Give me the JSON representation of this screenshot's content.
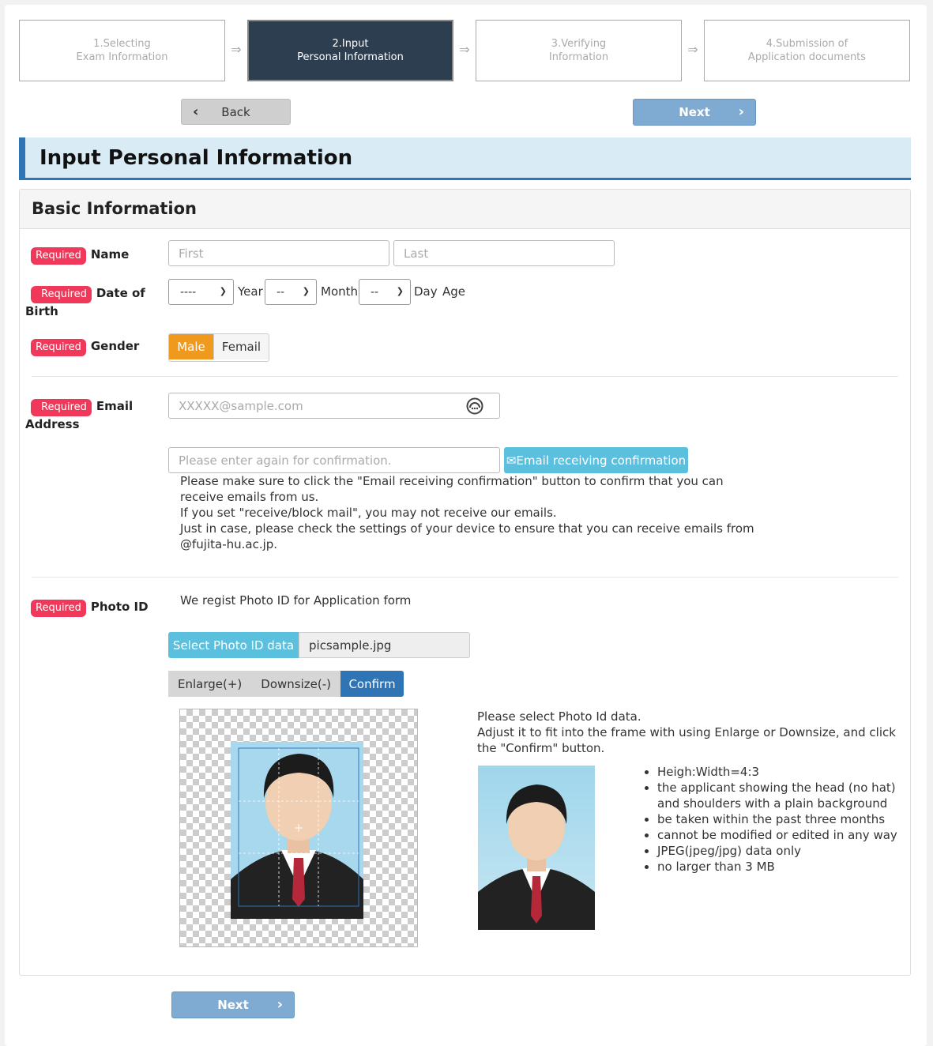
{
  "steps": [
    {
      "line1": "1.Selecting",
      "line2": "Exam Information",
      "active": false
    },
    {
      "line1": "2.Input",
      "line2": "Personal Information",
      "active": true
    },
    {
      "line1": "3.Verifying",
      "line2": "Information",
      "active": false
    },
    {
      "line1": "4.Submission of",
      "line2": "Application documents",
      "active": false
    }
  ],
  "step_arrow": "⇒",
  "nav": {
    "back_label": "Back",
    "next_label": "Next"
  },
  "page_title": "Input Personal Information",
  "section_title": "Basic Information",
  "required_badge": "Required",
  "name": {
    "label": "Name",
    "first_placeholder": "First",
    "last_placeholder": "Last"
  },
  "dob": {
    "label": "Date of Birth",
    "year_value": "----",
    "year_label": "Year",
    "month_value": "--",
    "month_label": "Month",
    "day_value": "--",
    "day_label": "Day",
    "age_label": "Age"
  },
  "gender": {
    "label": "Gender",
    "options": [
      "Male",
      "Femail"
    ],
    "selected": "Male"
  },
  "email": {
    "label": "Email Address",
    "placeholder": "XXXXX@sample.com",
    "confirm_placeholder": "Please enter again for confirmation.",
    "confirm_button": "✉Email receiving confirmation",
    "note": [
      "Please make sure to click the \"Email receiving confirmation\" button to confirm that you can receive emails from us.",
      "If you set \"receive/block mail\", you may not receive our emails.",
      "Just in case, please check the settings of your device to ensure that you can receive emails from @fujita-hu.ac.jp."
    ]
  },
  "photo": {
    "label": "Photo ID",
    "description": "We regist Photo ID for Application form",
    "select_button": "Select Photo ID data",
    "file_name": "picsample.jpg",
    "enlarge_label": "Enlarge(+)",
    "downsize_label": "Downsize(-)",
    "confirm_label": "Confirm",
    "hint": [
      "Please select Photo Id data.",
      "Adjust it to fit into the frame with using Enlarge or Downsize, and click the \"Confirm\" button."
    ],
    "rules": [
      "Heigh:Width=4:3",
      "the applicant showing the head (no hat) and shoulders with a plain background",
      "be taken within the past three months",
      "cannot be modified or edited in any way",
      "JPEG(jpeg/jpg) data only",
      "no larger than 3 MB"
    ]
  },
  "colors": {
    "accent": "#2f74b5",
    "required": "#f0385a",
    "next": "#7faad2",
    "info": "#5bc0de",
    "male": "#ef9a1e"
  }
}
